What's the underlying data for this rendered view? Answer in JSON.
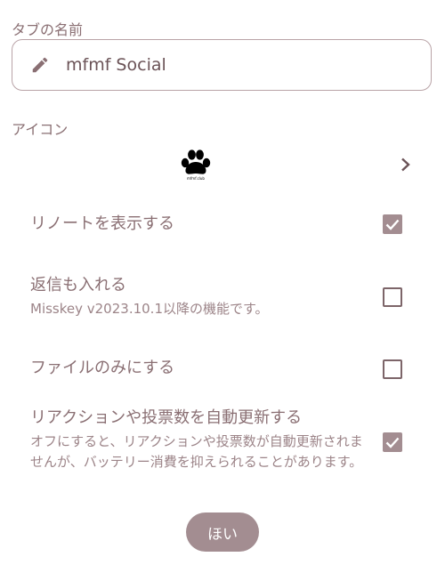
{
  "tab_name": {
    "label": "タブの名前",
    "value": "mfmf Social",
    "icon": "pencil-icon"
  },
  "icon_section": {
    "label": "アイコン",
    "icon_caption": "mfmf.club",
    "chevron": "chevron-right-icon"
  },
  "options": [
    {
      "title": "リノートを表示する",
      "description": "",
      "checked": true
    },
    {
      "title": "返信も入れる",
      "description": "Misskey v2023.10.1以降の機能です。",
      "checked": false
    },
    {
      "title": "ファイルのみにする",
      "description": "",
      "checked": false
    },
    {
      "title": "リアクションや投票数を自動更新する",
      "description": "オフにすると、リアクションや投票数が自動更新されませんが、バッテリー消費を抑えられることがあります。",
      "checked": true
    }
  ],
  "ok_button": {
    "label": "ほい"
  },
  "colors": {
    "accent": "#a38d91",
    "text": "#8a6f73",
    "border": "#b9a3a7"
  }
}
